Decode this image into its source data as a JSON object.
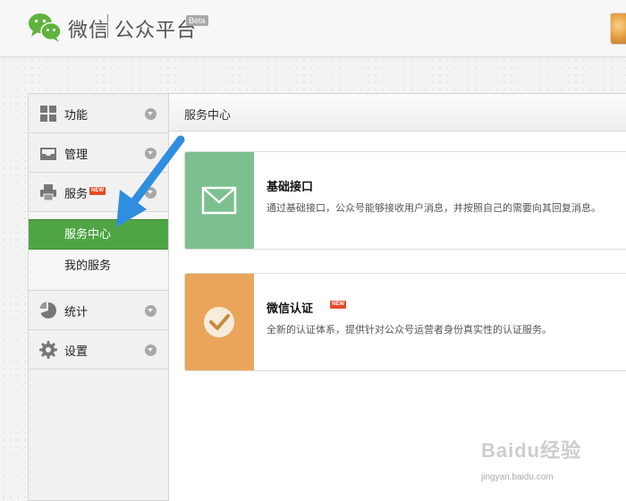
{
  "header": {
    "brand": "微信",
    "platform": "公众平台",
    "beta": "Beta"
  },
  "sidebar": {
    "groups": [
      {
        "label": "功能",
        "icon": "grid-icon"
      },
      {
        "label": "管理",
        "icon": "inbox-icon"
      },
      {
        "label": "服务",
        "icon": "printer-icon",
        "badge": "NEW"
      },
      {
        "label": "统计",
        "icon": "pie-chart-icon"
      },
      {
        "label": "设置",
        "icon": "gear-icon"
      }
    ],
    "sub_items": [
      {
        "label": "服务中心",
        "active": true
      },
      {
        "label": "我的服务",
        "active": false
      }
    ]
  },
  "main": {
    "title": "服务中心",
    "cards": [
      {
        "title": "基础接口",
        "description": "通过基础接口，公众号能够接收用户消息，并按照自己的需要向其回复消息。",
        "icon": "envelope-icon",
        "color": "#7cc08f"
      },
      {
        "title": "微信认证",
        "badge": "NEW",
        "description": "全新的认证体系，提供针对公众号运营者身份真实性的认证服务。",
        "icon": "checkmark-icon",
        "color": "#e9a65a"
      }
    ]
  },
  "watermark": {
    "main": "Baidu经验",
    "sub": "jingyan.baidu.com"
  },
  "colors": {
    "active_green": "#4fa544",
    "arrow_blue": "#2f8ee0",
    "badge_red": "#e24b2a"
  }
}
